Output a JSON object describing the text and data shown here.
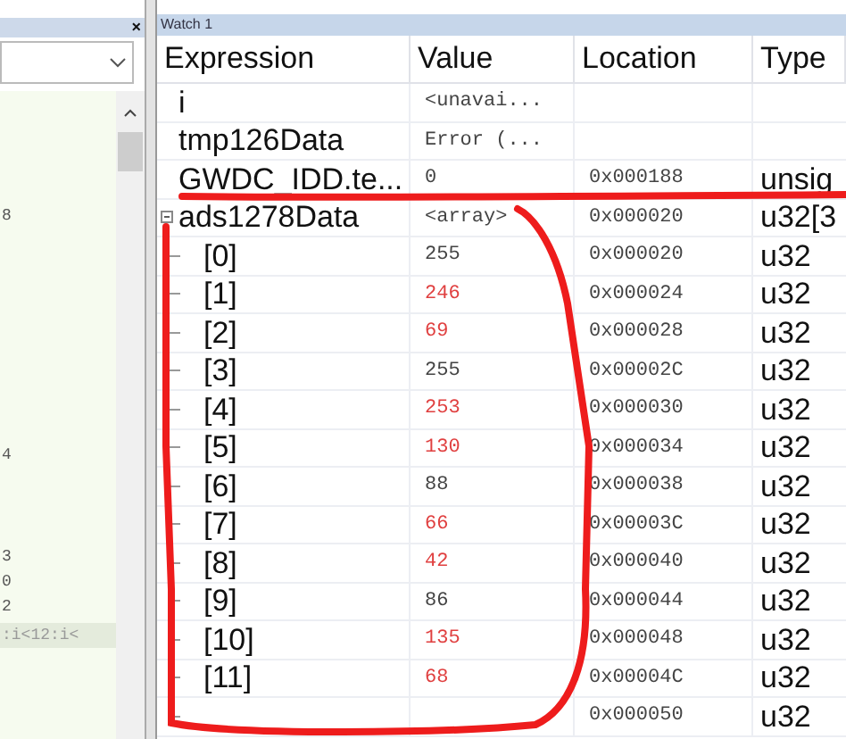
{
  "left_panel": {
    "close": "×",
    "code_lines": [
      {
        "text": "8",
        "highlighted": false
      },
      {
        "text": "4",
        "highlighted": false
      },
      {
        "text": "3",
        "highlighted": false
      },
      {
        "text": "0",
        "highlighted": false
      },
      {
        "text": "2",
        "highlighted": false
      },
      {
        "text": ":i<12:i<",
        "highlighted": true
      }
    ]
  },
  "watch": {
    "title": "Watch 1",
    "columns": [
      "Expression",
      "Value",
      "Location",
      "Type"
    ],
    "rows": [
      {
        "expression": "i",
        "value": "<unavai...",
        "changed": false
      },
      {
        "expression": "tmp126Data",
        "value": "Error (...",
        "changed": false
      },
      {
        "expression": "GWDC_IDD.te...",
        "value": "0",
        "location": "0x000188",
        "type": "unsig",
        "changed": false
      },
      {
        "expression": "ads1278Data",
        "value": "<array>",
        "location": "0x000020",
        "type": "u32[3",
        "changed": false,
        "expanded": true,
        "children": [
          {
            "expression": "[0]",
            "value": "255",
            "location": "0x000020",
            "type": "u32",
            "changed": false
          },
          {
            "expression": "[1]",
            "value": "246",
            "location": "0x000024",
            "type": "u32",
            "changed": true
          },
          {
            "expression": "[2]",
            "value": "69",
            "location": "0x000028",
            "type": "u32",
            "changed": true
          },
          {
            "expression": "[3]",
            "value": "255",
            "location": "0x00002C",
            "type": "u32",
            "changed": false
          },
          {
            "expression": "[4]",
            "value": "253",
            "location": "0x000030",
            "type": "u32",
            "changed": true
          },
          {
            "expression": "[5]",
            "value": "130",
            "location": "0x000034",
            "type": "u32",
            "changed": true
          },
          {
            "expression": "[6]",
            "value": "88",
            "location": "0x000038",
            "type": "u32",
            "changed": false
          },
          {
            "expression": "[7]",
            "value": "66",
            "location": "0x00003C",
            "type": "u32",
            "changed": true
          },
          {
            "expression": "[8]",
            "value": "42",
            "location": "0x000040",
            "type": "u32",
            "changed": true
          },
          {
            "expression": "[9]",
            "value": "86",
            "location": "0x000044",
            "type": "u32",
            "changed": false
          },
          {
            "expression": "[10]",
            "value": "135",
            "location": "0x000048",
            "type": "u32",
            "changed": true
          },
          {
            "expression": "[11]",
            "value": "68",
            "location": "0x00004C",
            "type": "u32",
            "changed": true
          },
          {
            "location": "0x000050",
            "type": "u32"
          }
        ]
      }
    ]
  }
}
